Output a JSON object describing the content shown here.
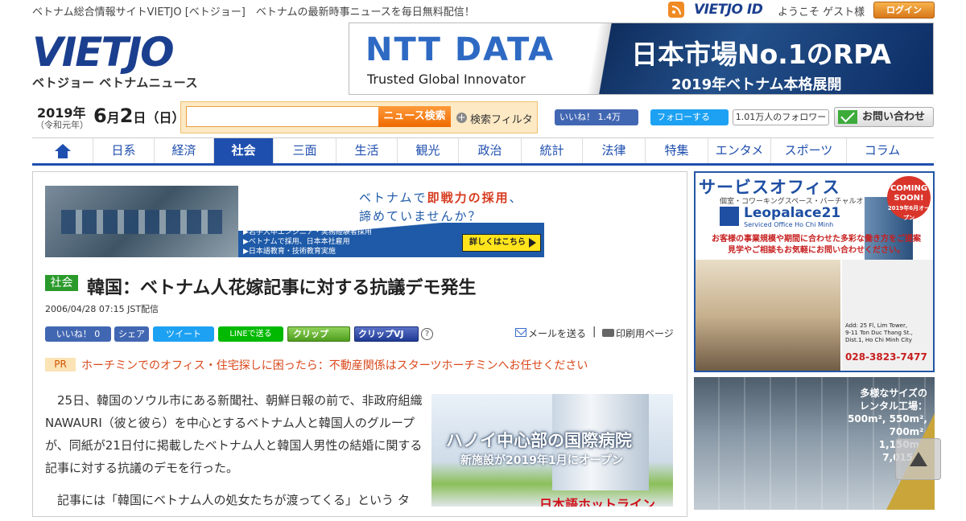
{
  "header": {
    "tagline": "ベトナム総合情報サイトVIETJO [ベトジョー]　ベトナムの最新時事ニュースを毎日無料配信！",
    "vietjo_id": "VIETJO ID",
    "welcome": "ようこそ ゲスト様",
    "login_label": "ログイン",
    "logo_main": "VIET",
    "logo_accent": "JO",
    "logo_sub": "ベトジョー ベトナムニュース"
  },
  "top_banner": {
    "brand": "NTT DATA",
    "tagline": "Trusted Global Innovator",
    "headline": "日本市場No.1のRPA",
    "sub": "2019年ベトナム本格展開"
  },
  "date": {
    "year": "2019年",
    "era": "（令和元年）",
    "month": "6",
    "month_unit": "月",
    "day": "2",
    "day_unit": "日",
    "weekday": "（日）"
  },
  "search": {
    "placeholder": "",
    "button_label": "ニュース検索",
    "filter_label": "検索フィルタ"
  },
  "social_top": {
    "fb_like": "いいね！ 1.4万",
    "tw_follow": "フォローする",
    "tw_followers": "1.01万人のフォロワー",
    "contact": "お問い合わせ"
  },
  "nav": {
    "items": [
      {
        "label": "",
        "icon": "home-icon"
      },
      {
        "label": "日系"
      },
      {
        "label": "経済"
      },
      {
        "label": "社会",
        "active": true
      },
      {
        "label": "三面"
      },
      {
        "label": "生活"
      },
      {
        "label": "観光"
      },
      {
        "label": "政治"
      },
      {
        "label": "統計"
      },
      {
        "label": "法律"
      },
      {
        "label": "特集"
      },
      {
        "label": "エンタメ"
      },
      {
        "label": "スポーツ"
      },
      {
        "label": "コラム"
      }
    ]
  },
  "ad_recruit": {
    "head1_pre": "ベトナムで",
    "head1_hl": "即戦力の採用",
    "head1_post": "、",
    "head2": "諦めていませんか？",
    "bullets": [
      "▶若手大卒エンジニア・実務経験者採用",
      "▶ベトナムで採用、日本本社雇用",
      "▶日本語教育・技術教育実施"
    ],
    "cta": "詳しくはこちら"
  },
  "article": {
    "category": "社会",
    "title": "韓国：ベトナム人花嫁記事に対する抗議デモ発生",
    "date": "2006/04/28 07:15 JST配信",
    "paragraphs": [
      "25日、韓国のソウル市にある新聞社、朝鮮日報の前で、非政府組織NAWAURI（彼と彼ら）を中心とするベトナム人と韓国人のグループが、同紙が21日付に掲載したベトナム人と韓国人男性の結婚に関する記事に対する抗議のデモを行った。",
      "記事には「韓国にベトナム人の処女たちが渡ってくる」という タ"
    ]
  },
  "share": {
    "fb": "いいね！ 0",
    "fb_share": "シェア",
    "tweet": "ツイート",
    "line": "LINEで送る",
    "clip1": "クリップ",
    "clip2": "クリップVJ",
    "help": "?",
    "mail": "メールを送る",
    "separator": "|",
    "print": "印刷用ページ"
  },
  "pr": {
    "badge": "PR",
    "text": "ホーチミンでのオフィス・住宅探しに困ったら：不動産関係はスターツホーチミンへお任せください"
  },
  "hospital_ad": {
    "title": "ハノイ中心部の国際病院",
    "sub": "新施設が2019年1月にオープン",
    "hotline": "日本語ホットライン"
  },
  "side_ad1": {
    "title": "サービスオフィス",
    "sub": "個室・コワーキングスペース・バーチャルオフィス",
    "soon": "COMING SOON!",
    "soon_date": "2019年6月オープン",
    "logo": "Leopalace21",
    "logo_sub": "Serviced Office Ho Chi Minh",
    "red_line1": "お客様の事業規模や期間に合わせた多彩な働き方をご提案",
    "red_line2": "見学やご相談もお気軽にお問い合わせください。",
    "address": [
      "Add: 25 Fl, Lim Tower,",
      "9-11 Ton Duc Thang St.,",
      "Dist.1, Ho Chi Minh City"
    ],
    "phone": "028-3823-7477"
  },
  "side_ad2": {
    "lines": [
      "多様なサイズの",
      "レンタル工場：",
      "500m², 550m²,",
      "700m², 1,150m²,",
      "7,015m²"
    ]
  },
  "colors": {
    "brand_blue": "#1f4fae",
    "accent_orange": "#ee6a00",
    "category_green": "#2a9a2a",
    "pr_red": "#d9481c"
  }
}
